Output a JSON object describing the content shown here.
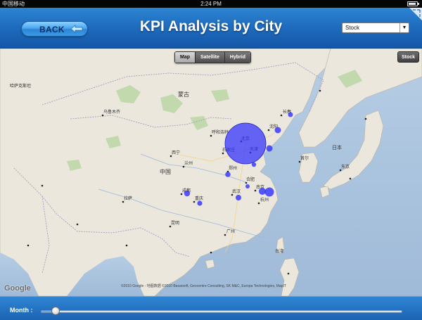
{
  "status_bar": {
    "carrier": "中国移动",
    "time": "2:24 PM"
  },
  "header": {
    "back_label": "BACK",
    "title": "KPI Analysis by City",
    "metric_select": {
      "value": "Stock"
    }
  },
  "map": {
    "type_buttons": [
      "Map",
      "Satellite",
      "Hybrid"
    ],
    "active_type": "Map",
    "stock_button": "Stock",
    "logo": "Google",
    "copyright": "©2010 Google - 地图数据 ©2010 Basarsoft, Geocentre Consulting, SK M&C, Europa Technologies, MapIT",
    "labels": [
      {
        "id": "mongolia",
        "text": "蒙古"
      },
      {
        "id": "china",
        "text": "中国"
      },
      {
        "id": "beijing",
        "text": "北京"
      },
      {
        "id": "hohhot",
        "text": "呼和浩特"
      },
      {
        "id": "tianjin",
        "text": "天津"
      },
      {
        "id": "shijiazhuang",
        "text": "石家庄"
      },
      {
        "id": "shenyang",
        "text": "沈阳"
      },
      {
        "id": "changchun",
        "text": "长春"
      },
      {
        "id": "zhengzhou",
        "text": "郑州"
      },
      {
        "id": "wuhan",
        "text": "武汉"
      },
      {
        "id": "hefei",
        "text": "合肥"
      },
      {
        "id": "hangzhou",
        "text": "杭州"
      },
      {
        "id": "nanjing",
        "text": "南京"
      },
      {
        "id": "chengdu",
        "text": "成都"
      },
      {
        "id": "chongqing",
        "text": "重庆"
      },
      {
        "id": "guangzhou",
        "text": "广州"
      },
      {
        "id": "xining",
        "text": "西宁"
      },
      {
        "id": "lanzhou",
        "text": "兰州"
      },
      {
        "id": "urumqi",
        "text": "乌鲁木齐"
      },
      {
        "id": "lhasa",
        "text": "拉萨"
      },
      {
        "id": "japan",
        "text": "日本"
      },
      {
        "id": "tokyo",
        "text": "东京"
      },
      {
        "id": "seoul",
        "text": "首尔"
      },
      {
        "id": "kazakh",
        "text": "哈萨克斯坦"
      },
      {
        "id": "kunming",
        "text": "昆明"
      },
      {
        "id": "taiwan",
        "text": "台湾"
      }
    ],
    "bubbles": [
      {
        "city": "北京",
        "value": 100
      },
      {
        "city": "沈阳",
        "value": 12
      },
      {
        "city": "长春",
        "value": 5
      },
      {
        "city": "天津",
        "value": 8
      },
      {
        "city": "济南",
        "value": 3
      },
      {
        "city": "郑州",
        "value": 4
      },
      {
        "city": "武汉",
        "value": 4
      },
      {
        "city": "合肥",
        "value": 3
      },
      {
        "city": "杭州",
        "value": 12
      },
      {
        "city": "南京",
        "value": 10
      },
      {
        "city": "成都",
        "value": 5
      },
      {
        "city": "重庆",
        "value": 4
      }
    ]
  },
  "footer": {
    "month_label": "Month :",
    "slider_value": 0.04
  },
  "colors": {
    "header": "#1e6bbd",
    "bubble": "#2f2fff",
    "water": "#a9c1dc",
    "land": "#ebe7dc"
  }
}
